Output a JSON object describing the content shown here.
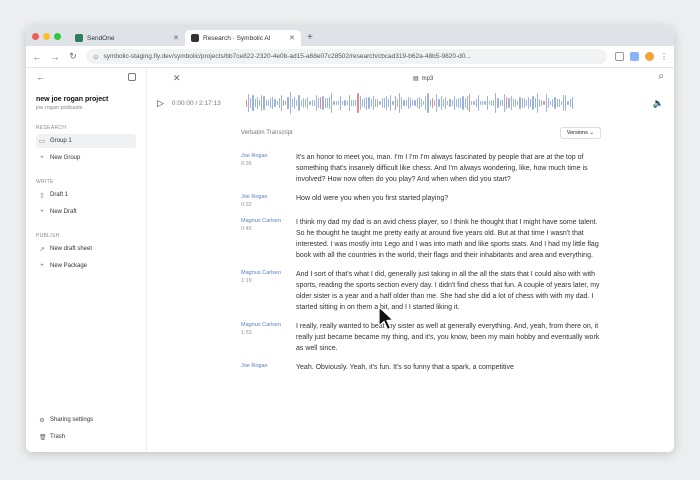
{
  "browser": {
    "tabs": [
      {
        "title": "SendOne",
        "active": false,
        "favicon_color": "#2f7d5b"
      },
      {
        "title": "Research · Symbolic AI",
        "active": true,
        "favicon_color": "#333333"
      }
    ],
    "url": "symbolic-staging.fly.dev/symbolic/projects/bb7ce822-2320-4e0b-ad15-a68e07c28502/research/cbcad319-b62a-48b5-9820-d0..."
  },
  "sidebar": {
    "project_title": "new joe rogan project",
    "project_subtitle": "joe rogan podcasts",
    "sections": [
      {
        "heading": "RESEARCH",
        "items": [
          {
            "label": "Group 1",
            "icon": "folder-icon",
            "active": true
          },
          {
            "label": "New Group",
            "icon": "plus-icon",
            "active": false
          }
        ]
      },
      {
        "heading": "WRITE",
        "items": [
          {
            "label": "Draft 1",
            "icon": "doc-icon",
            "active": false
          },
          {
            "label": "New Draft",
            "icon": "plus-icon",
            "active": false
          }
        ]
      },
      {
        "heading": "PUBLISH",
        "items": [
          {
            "label": "New draft sheet",
            "icon": "share-icon",
            "active": false
          },
          {
            "label": "New Package",
            "icon": "plus-icon",
            "active": false
          }
        ]
      }
    ],
    "bottom": [
      {
        "label": "Sharing settings",
        "icon": "gear-icon"
      },
      {
        "label": "Trash",
        "icon": "trash-icon"
      }
    ]
  },
  "player": {
    "file_label": "mp3",
    "time": "0:00:00 / 2:17:13"
  },
  "transcript": {
    "heading": "Verbatim Transcript",
    "versions_label": "Versions",
    "entries": [
      {
        "speaker": "Joe Rogan",
        "ts": "0:36",
        "text": "It's an honor to meet you, man. I'm I I'm I'm always fascinated by people that are at the top of something that's insanely difficult like chess. And I'm always wondering, like, how much time is involved? How now often do you play? And when when did you start?"
      },
      {
        "speaker": "Joe Rogan",
        "ts": "0:32",
        "text": "How old were you when you first started playing?"
      },
      {
        "speaker": "Magnus Carlsen",
        "ts": "0:45",
        "text": "I think my dad my dad is an avid chess player, so I think he thought that I might have some talent. So he thought he taught me pretty early at around five years old. But at that time I wasn't that interested. I was mostly into Lego and I was into math and like sports stats. And I had my little flag book with all the countries in the world, their flags and their inhabitants and area and everything."
      },
      {
        "speaker": "Magnus Carlsen",
        "ts": "1:19",
        "text": "And I sort of that's what I did, generally just taking in all the all the stats that I could also with with sports, reading the sports section every day. I didn't find chess that fun. A couple of years later, my older sister is a year and a half older than me. She had she did a lot of chess with with my dad. I started sitting in on them a bit, and I I started liking it."
      },
      {
        "speaker": "Magnus Carlsen",
        "ts": "1:53",
        "text": "I really, really wanted to beat my sister as well at generally everything. And, yeah, from there on, it really just became became my thing, and it's, you know, been my main hobby and eventually work as well since."
      },
      {
        "speaker": "Joe Rogan",
        "ts": "",
        "text": "Yeah. Obviously. Yeah, it's fun. It's so funny that a spark, a competitive"
      }
    ]
  }
}
